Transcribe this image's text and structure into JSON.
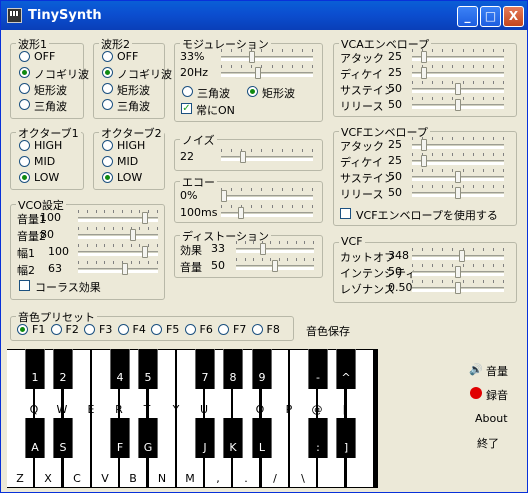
{
  "window": {
    "title": "TinySynth",
    "minimize": "_",
    "maximize": "□",
    "close": "X"
  },
  "wave1": {
    "legend": "波形1",
    "options": [
      "OFF",
      "ノコギリ波",
      "矩形波",
      "三角波"
    ],
    "selected": 1
  },
  "wave2": {
    "legend": "波形2",
    "options": [
      "OFF",
      "ノコギリ波",
      "矩形波",
      "三角波"
    ],
    "selected": 1
  },
  "oct1": {
    "legend": "オクターブ1",
    "options": [
      "HIGH",
      "MID",
      "LOW"
    ],
    "selected": 2
  },
  "oct2": {
    "legend": "オクターブ2",
    "options": [
      "HIGH",
      "MID",
      "LOW"
    ],
    "selected": 2
  },
  "vco": {
    "legend": "VCO設定",
    "rows": [
      {
        "label": "音量1",
        "value": "100",
        "level": 0.86
      },
      {
        "label": "音量2",
        "value": "80",
        "level": 0.7
      },
      {
        "label": "幅1",
        "value": "100",
        "level": 0.86
      },
      {
        "label": "幅2",
        "value": "63",
        "level": 0.6
      }
    ],
    "chorus_label": "コーラス効果",
    "chorus_checked": false
  },
  "modulation": {
    "legend": "モジュレーション",
    "rows": [
      {
        "value": "33%",
        "level": 0.32
      },
      {
        "value": "20Hz",
        "level": 0.4
      }
    ],
    "options": [
      "三角波",
      "矩形波"
    ],
    "selected": 1,
    "always_on_label": "常にON",
    "always_on_checked": true
  },
  "noise": {
    "legend": "ノイズ",
    "value": "22",
    "level": 0.22
  },
  "echo": {
    "legend": "エコー",
    "rows": [
      {
        "value": "0%",
        "level": 0.0
      },
      {
        "value": "100ms",
        "level": 0.2
      }
    ]
  },
  "distortion": {
    "legend": "ディストーション",
    "rows": [
      {
        "label": "効果",
        "value": "33",
        "level": 0.33
      },
      {
        "label": "音量",
        "value": "50",
        "level": 0.5
      }
    ]
  },
  "vca": {
    "legend": "VCAエンベロープ",
    "rows": [
      {
        "label": "アタック",
        "value": "25",
        "level": 0.1
      },
      {
        "label": "ディケイ",
        "value": "25",
        "level": 0.1
      },
      {
        "label": "サステイン",
        "value": "50",
        "level": 0.5
      },
      {
        "label": "リリース",
        "value": "50",
        "level": 0.5
      }
    ]
  },
  "vcf_env": {
    "legend": "VCFエンベロープ",
    "rows": [
      {
        "label": "アタック",
        "value": "25",
        "level": 0.1
      },
      {
        "label": "ディケイ",
        "value": "25",
        "level": 0.1
      },
      {
        "label": "サステイン",
        "value": "50",
        "level": 0.5
      },
      {
        "label": "リリース",
        "value": "50",
        "level": 0.5
      }
    ],
    "use_label": "VCFエンベロープを使用する",
    "use_checked": false
  },
  "vcf": {
    "legend": "VCF",
    "rows": [
      {
        "label": "カットオフ",
        "value": "348",
        "level": 0.55
      },
      {
        "label": "インテンシティ",
        "value": "50",
        "level": 0.5
      },
      {
        "label": "レゾナンス",
        "value": "0.50",
        "level": 0.5
      }
    ]
  },
  "preset": {
    "legend": "音色プリセット",
    "options": [
      "F1",
      "F2",
      "F3",
      "F4",
      "F5",
      "F6",
      "F7",
      "F8"
    ],
    "selected": 0,
    "save_label": "音色保存"
  },
  "keyboard": {
    "upper_black": [
      "1",
      "2",
      "4",
      "5",
      "7",
      "8",
      "9",
      "-",
      "^"
    ],
    "upper_white": [
      "Q",
      "W",
      "E",
      "R",
      "T",
      "Y",
      "U",
      "I",
      "O",
      "P",
      "@",
      "["
    ],
    "lower_black": [
      "A",
      "S",
      "F",
      "G",
      "J",
      "K",
      "L",
      ":",
      "]"
    ],
    "lower_white": [
      "Z",
      "X",
      "C",
      "V",
      "B",
      "N",
      "M",
      ",",
      ".",
      "/",
      "\\"
    ]
  },
  "side": {
    "volume": "音量",
    "record": "録音",
    "about": "About",
    "exit": "終了"
  }
}
